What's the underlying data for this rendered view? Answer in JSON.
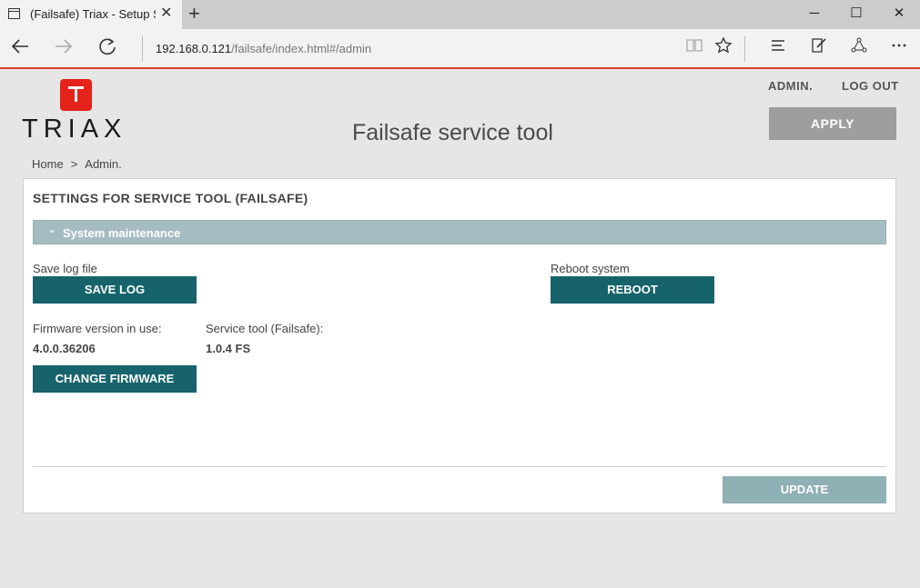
{
  "browser": {
    "tab_title": "(Failsafe) Triax - Setup S",
    "tab_close": "✕",
    "new_tab": "+",
    "url_host": "192.168.0.121",
    "url_path": "/failsafe/index.html#/admin",
    "window_controls": {
      "minimize": "─",
      "maximize": "☐",
      "close": "✕"
    },
    "icons": [
      "back-icon",
      "forward-icon",
      "refresh-icon",
      "reading-view-icon",
      "favorite-star-icon",
      "hub-icon",
      "web-note-icon",
      "share-icon",
      "more-icon"
    ]
  },
  "header": {
    "logo_text": "TRIAX",
    "title": "Failsafe service tool",
    "links": {
      "admin": "ADMIN.",
      "logout": "LOG OUT"
    },
    "apply_label": "APPLY"
  },
  "breadcrumb": {
    "home": "Home",
    "separator": ">",
    "current": "Admin."
  },
  "panel": {
    "title": "SETTINGS FOR SERVICE TOOL (FAILSAFE)",
    "section": {
      "chevron": "⌄",
      "label": "System maintenance"
    },
    "save_log": {
      "label": "Save log file",
      "button": "SAVE LOG"
    },
    "reboot": {
      "label": "Reboot system",
      "button": "REBOOT"
    },
    "firmware": {
      "label": "Firmware version in use:",
      "value": "4.0.0.36206",
      "button": "CHANGE FIRMWARE"
    },
    "service_tool": {
      "label": "Service tool (Failsafe):",
      "value": "1.0.4 FS"
    },
    "update_label": "UPDATE"
  },
  "colors": {
    "accent_red": "#e5231b",
    "button_teal": "#16636b",
    "section_bar": "#a5bcc2",
    "apply_gray": "#9e9e9e",
    "update_disabled": "#8fb0b5"
  }
}
